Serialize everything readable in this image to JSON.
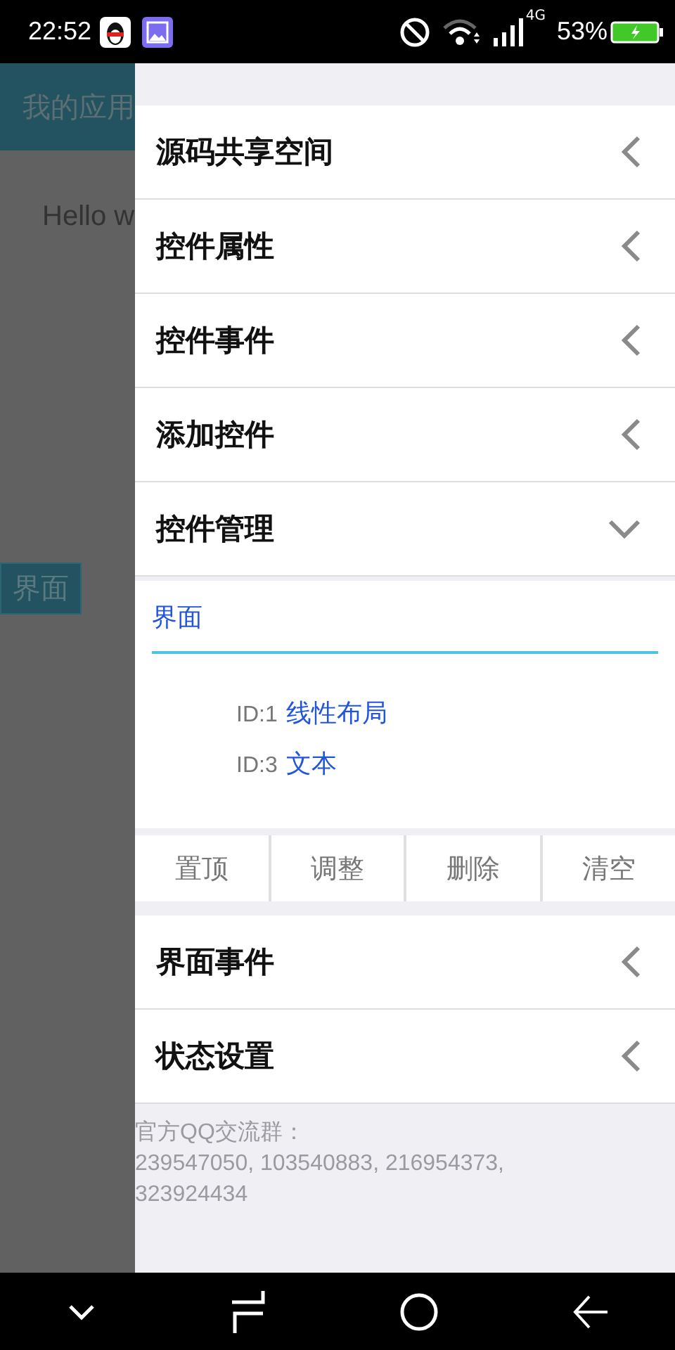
{
  "status_bar": {
    "time": "22:52",
    "network": "4G",
    "battery": "53%"
  },
  "app_behind": {
    "title": "我的应用",
    "text": "Hello w",
    "button": "界面"
  },
  "drawer": {
    "sections": [
      {
        "title": "源码共享空间",
        "expanded": false
      },
      {
        "title": "控件属性",
        "expanded": false
      },
      {
        "title": "控件事件",
        "expanded": false
      },
      {
        "title": "添加控件",
        "expanded": false
      },
      {
        "title": "控件管理",
        "expanded": true,
        "panel": {
          "field": "界面",
          "items": [
            {
              "id": "ID:1",
              "name": "线性布局"
            },
            {
              "id": "ID:3",
              "name": "文本"
            }
          ],
          "buttons": [
            "置顶",
            "调整",
            "删除",
            "清空"
          ]
        }
      },
      {
        "title": "界面事件",
        "expanded": false
      },
      {
        "title": "状态设置",
        "expanded": false
      }
    ],
    "footer": "官方QQ交流群：\n 239547050, 103540883, 216954373, 323924434"
  }
}
